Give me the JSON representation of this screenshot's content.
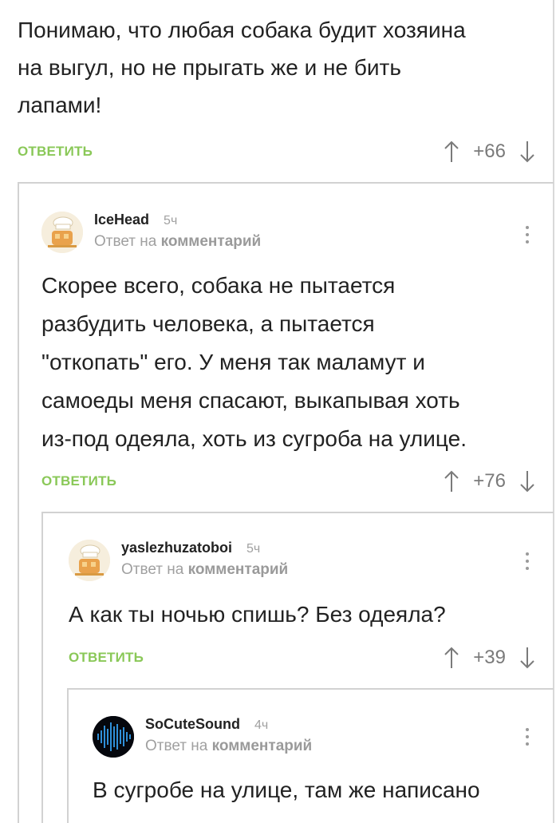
{
  "comments": [
    {
      "text_lines": [
        "Понимаю, что любая собака будит хозяина",
        "на выгул, но не прыгать же и не бить",
        "лапами!"
      ],
      "reply_label": "ОТВЕТИТЬ",
      "rating": "+66"
    },
    {
      "author": "IceHead",
      "time": "5ч",
      "reply_prefix": "Ответ на",
      "reply_target": "комментарий",
      "text_lines": [
        "Скорее всего, собака не пытается",
        "разбудить человека, а пытается",
        "\"откопать\" его. У меня так маламут и",
        "самоеды меня спасают, выкапывая хоть",
        "из-под одеяла, хоть из сугроба на улице."
      ],
      "reply_label": "ОТВЕТИТЬ",
      "rating": "+76"
    },
    {
      "author": "yaslezhuzatoboi",
      "time": "5ч",
      "reply_prefix": "Ответ на",
      "reply_target": "комментарий",
      "text_lines": [
        "А как ты ночью спишь? Без одеяла?"
      ],
      "reply_label": "ОТВЕТИТЬ",
      "rating": "+39"
    },
    {
      "author": "SoCuteSound",
      "time": "4ч",
      "reply_prefix": "Ответ на",
      "reply_target": "комментарий",
      "text_lines": [
        "В сугробе на улице, там же написано"
      ]
    }
  ],
  "colors": {
    "reply": "#8ac858",
    "muted": "#a0a0a0",
    "thread_line": "#d2d2d2"
  },
  "icons": {
    "upvote": "arrow-up-icon",
    "downvote": "arrow-down-icon",
    "menu": "more-vertical-icon"
  }
}
